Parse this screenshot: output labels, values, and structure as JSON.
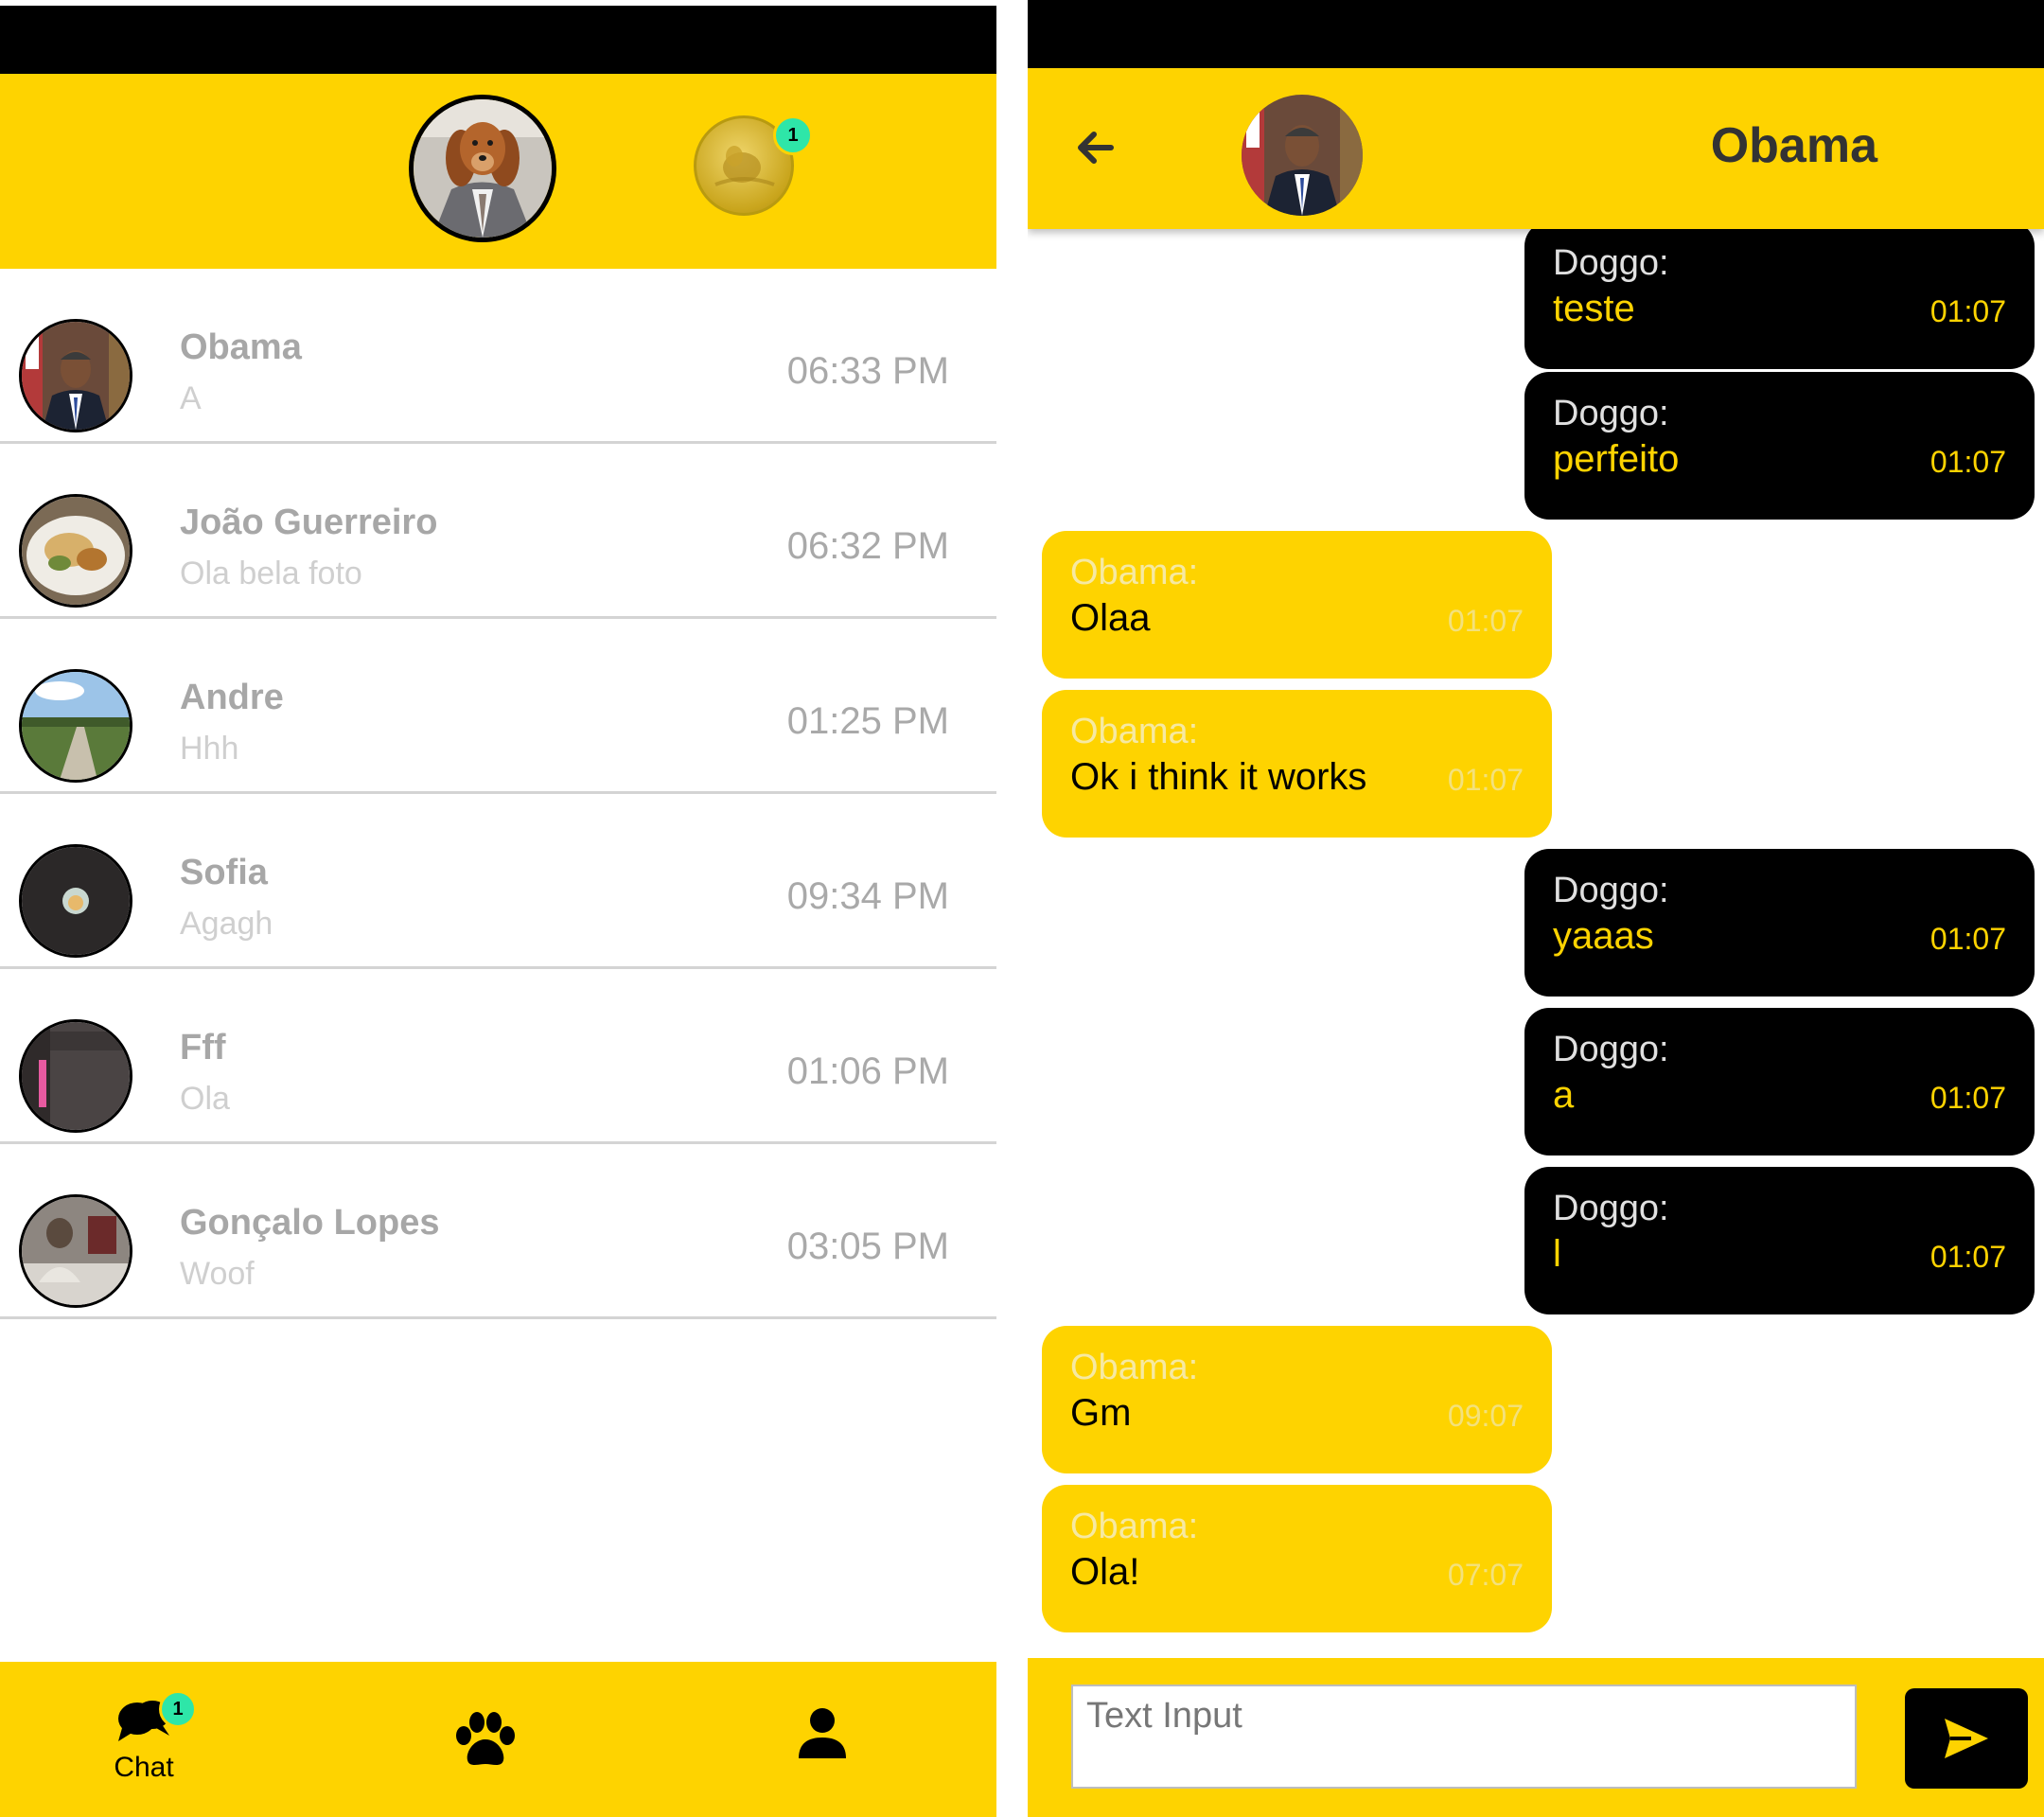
{
  "left": {
    "header": {
      "notification_count": "1"
    },
    "chats": [
      {
        "name": "Obama",
        "last_message": "A",
        "time": "06:33 PM"
      },
      {
        "name": "João Guerreiro",
        "last_message": "Ola bela foto",
        "time": "06:32 PM"
      },
      {
        "name": "Andre",
        "last_message": "Hhh",
        "time": "01:25 PM"
      },
      {
        "name": "Sofia",
        "last_message": "Agagh",
        "time": "09:34 PM"
      },
      {
        "name": "Fff",
        "last_message": "Ola",
        "time": "01:06 PM"
      },
      {
        "name": "Gonçalo Lopes",
        "last_message": "Woof",
        "time": "03:05 PM"
      }
    ],
    "bottom_nav": {
      "chat_label": "Chat",
      "chat_badge": "1",
      "paw_icon": "paw-icon",
      "profile_icon": "person-icon"
    }
  },
  "right": {
    "header": {
      "title": "Obama",
      "back_icon": "arrow-left-icon"
    },
    "messages": [
      {
        "direction": "out",
        "sender": "Doggo:",
        "text": "teste",
        "time": "01:07"
      },
      {
        "direction": "out",
        "sender": "Doggo:",
        "text": "perfeito",
        "time": "01:07"
      },
      {
        "direction": "in",
        "sender": "Obama:",
        "text": "Olaa",
        "time": "01:07"
      },
      {
        "direction": "in",
        "sender": "Obama:",
        "text": "Ok i think it works",
        "time": "01:07"
      },
      {
        "direction": "out",
        "sender": "Doggo:",
        "text": "yaaas",
        "time": "01:07"
      },
      {
        "direction": "out",
        "sender": "Doggo:",
        "text": "a",
        "time": "01:07"
      },
      {
        "direction": "out",
        "sender": "Doggo:",
        "text": "l",
        "time": "01:07"
      },
      {
        "direction": "in",
        "sender": "Obama:",
        "text": "Gm",
        "time": "09:07"
      },
      {
        "direction": "in",
        "sender": "Obama:",
        "text": "Ola!",
        "time": "07:07"
      }
    ],
    "input": {
      "placeholder": "Text Input",
      "value": ""
    },
    "send_icon": "send-icon"
  },
  "colors": {
    "accent": "#FED300",
    "badge": "#2EE6A8",
    "dark": "#000000"
  }
}
